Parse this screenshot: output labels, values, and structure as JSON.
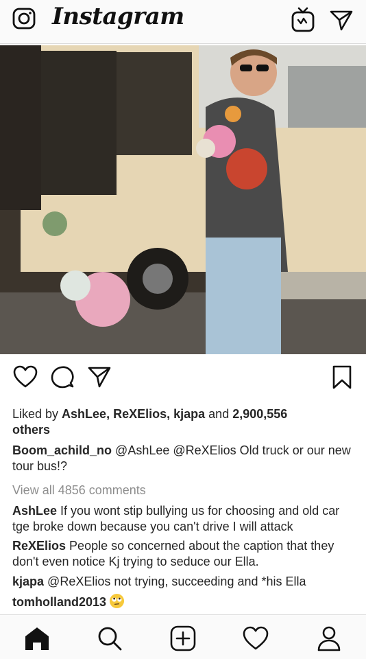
{
  "app": {
    "title": "Instagram"
  },
  "header": {
    "icons": [
      "camera-icon",
      "igtv-icon",
      "direct-message-icon"
    ]
  },
  "post": {
    "actions": [
      "like-icon",
      "comment-icon",
      "share-icon",
      "bookmark-icon"
    ],
    "likes": {
      "prefix": "Liked by ",
      "user1": "AshLee",
      "sep1": ", ",
      "user2": "ReXElios",
      "sep2": ", ",
      "user3": "kjapa",
      "and": " and ",
      "count": "2,900,556",
      "others": "others"
    },
    "caption": {
      "user": "Boom_achild_no",
      "text": "@AshLee @ReXElios Old truck or our new tour bus!?"
    },
    "view_all": "View all 4856 comments",
    "comments": [
      {
        "user": "AshLee",
        "text": "If you wont stip bullying us for choosing and old car tge broke down because you can't drive I will attack"
      },
      {
        "user": "ReXElios",
        "text": "People so concerned about the caption that they don't even notice Kj trying to seduce our Ella."
      },
      {
        "user": "kjapa",
        "text": "@ReXElios not trying, succeeding and *his Ella"
      },
      {
        "user": "tomholland2013",
        "emoji": "face-with-rolling-eyes"
      }
    ]
  },
  "bottom_nav": [
    "home-icon",
    "search-icon",
    "new-post-icon",
    "activity-heart-icon",
    "profile-icon"
  ]
}
